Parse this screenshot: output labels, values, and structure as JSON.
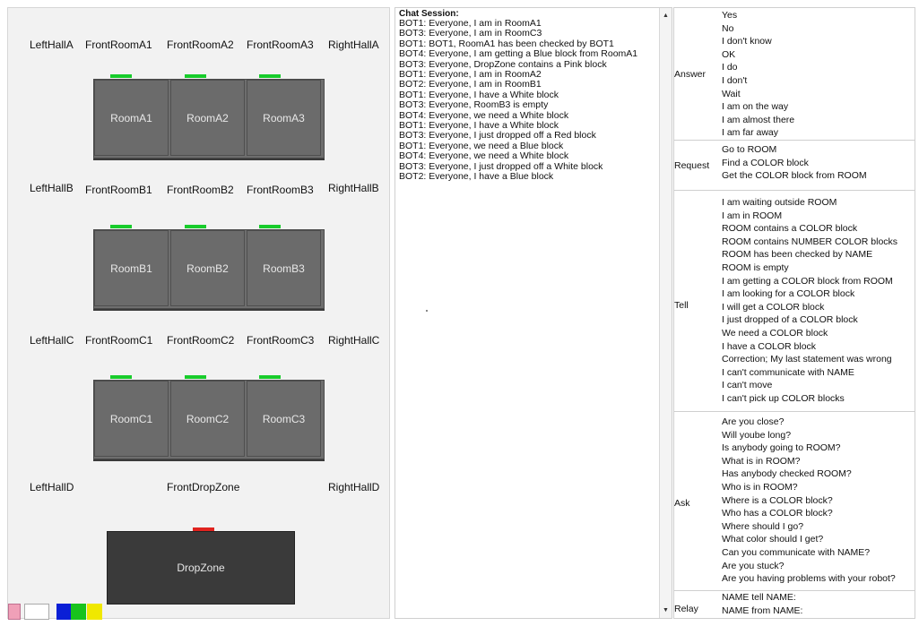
{
  "map": {
    "hall_labels": {
      "row_a": [
        "LeftHallA",
        "FrontRoomA1",
        "FrontRoomA2",
        "FrontRoomA3",
        "RightHallA"
      ],
      "row_b": [
        "LeftHallB",
        "FrontRoomB1",
        "FrontRoomB2",
        "FrontRoomB3",
        "RightHallB"
      ],
      "row_c": [
        "LeftHallC",
        "FrontRoomC1",
        "FrontRoomC2",
        "FrontRoomC3",
        "RightHallC"
      ],
      "row_d": [
        "LeftHallD",
        "FrontDropZone",
        "RightHallD"
      ]
    },
    "rooms": {
      "a": [
        "RoomA1",
        "RoomA2",
        "RoomA3"
      ],
      "b": [
        "RoomB1",
        "RoomB2",
        "RoomB3"
      ],
      "c": [
        "RoomC1",
        "RoomC2",
        "RoomC3"
      ]
    },
    "dropzone": "DropZone",
    "door_color": "#18cc2b",
    "dropzone_door_color": "#e0231f",
    "swatches": [
      "#f0a0b8",
      "#ffffff",
      "#0a1fd6",
      "#18c31d",
      "#f0e800"
    ]
  },
  "chat": {
    "title": "Chat Session:",
    "lines": [
      "BOT1: Everyone, I am in RoomA1",
      "BOT3: Everyone, I am in RoomC3",
      "BOT1: BOT1, RoomA1 has been checked by BOT1",
      "BOT4: Everyone, I am getting a Blue block from RoomA1",
      "BOT3: Everyone, DropZone contains a Pink block",
      "BOT1: Everyone, I am in RoomA2",
      "BOT2: Everyone, I am in RoomB1",
      "BOT1: Everyone, I have a White block",
      "BOT3: Everyone, RoomB3 is empty",
      "BOT4: Everyone, we need a White block",
      "BOT1: Everyone, I have a White block",
      "BOT3: Everyone, I just dropped off a Red block",
      "BOT1: Everyone, we need a Blue block",
      "BOT4: Everyone, we need a White block",
      "BOT3: Everyone, I just dropped off a White block",
      "BOT2: Everyone, I have a Blue block"
    ],
    "scroll_up_icon": "▲",
    "scroll_down_icon": "▼"
  },
  "commands": {
    "answer": {
      "label": "Answer",
      "options": [
        "Yes",
        "No",
        "I don't know",
        "OK",
        "I do",
        "I don't",
        "Wait",
        "I am on the way",
        "I am almost there",
        "I am far away"
      ]
    },
    "request": {
      "label": "Request",
      "options": [
        "Go to ROOM",
        "Find a COLOR block",
        "Get the COLOR block from ROOM"
      ]
    },
    "tell": {
      "label": "Tell",
      "options": [
        "I am waiting outside ROOM",
        "I am in ROOM",
        "ROOM contains a COLOR block",
        "ROOM contains NUMBER COLOR blocks",
        "ROOM has been checked by NAME",
        "ROOM is empty",
        "I am getting a COLOR block from ROOM",
        "I am looking for a COLOR block",
        "I will get a COLOR block",
        "I just dropped of a COLOR block",
        "We need a COLOR block",
        "I have a COLOR block",
        "Correction; My last statement was wrong",
        "I can't communicate with NAME",
        "I can't move",
        "I can't pick up COLOR blocks"
      ]
    },
    "ask": {
      "label": "Ask",
      "options": [
        "Are you close?",
        "Will yoube long?",
        "Is anybody going to ROOM?",
        "What is in ROOM?",
        "Has anybody checked ROOM?",
        "Who is in ROOM?",
        "Where is a COLOR block?",
        "Who has a COLOR block?",
        "Where should I go?",
        "What color should I get?",
        "Can you communicate with NAME?",
        "Are you stuck?",
        "Are you having problems with your robot?"
      ]
    },
    "relay": {
      "label": "Relay",
      "options": [
        "NAME tell NAME:",
        "NAME from NAME:"
      ]
    }
  }
}
